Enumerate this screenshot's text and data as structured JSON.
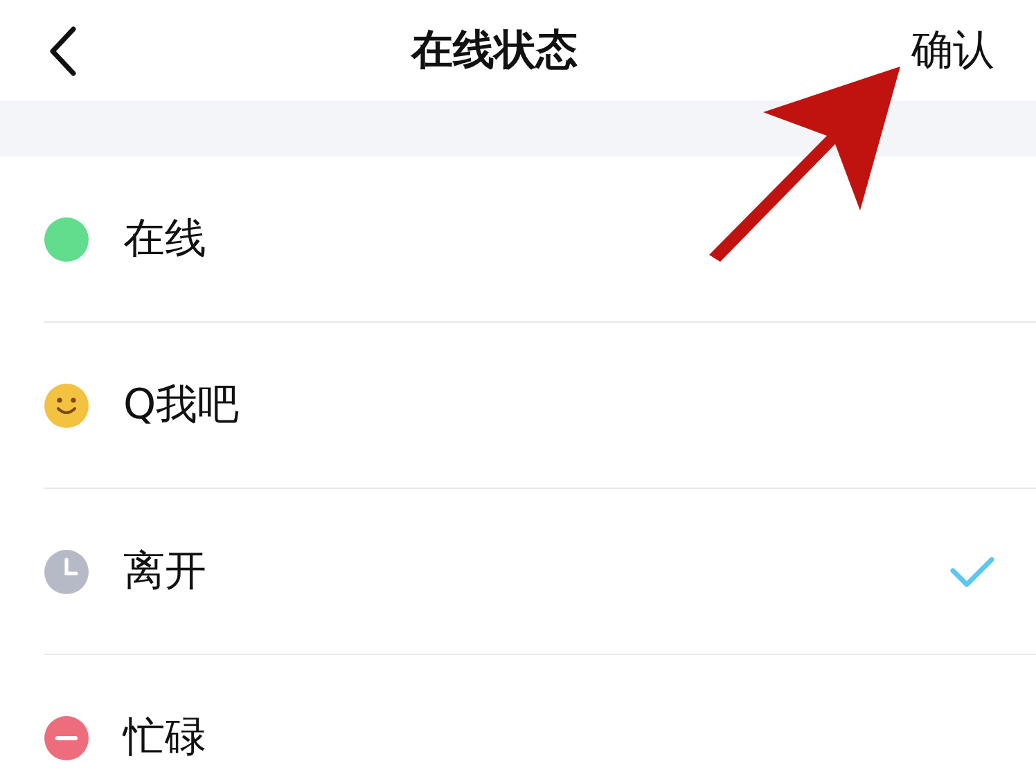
{
  "header": {
    "title": "在线状态",
    "confirm": "确认"
  },
  "statuses": [
    {
      "kind": "online",
      "label": "在线",
      "selected": false
    },
    {
      "kind": "smile",
      "label": "Q我吧",
      "selected": false
    },
    {
      "kind": "away",
      "label": "离开",
      "selected": true
    },
    {
      "kind": "busy",
      "label": "忙碌",
      "selected": false
    }
  ]
}
